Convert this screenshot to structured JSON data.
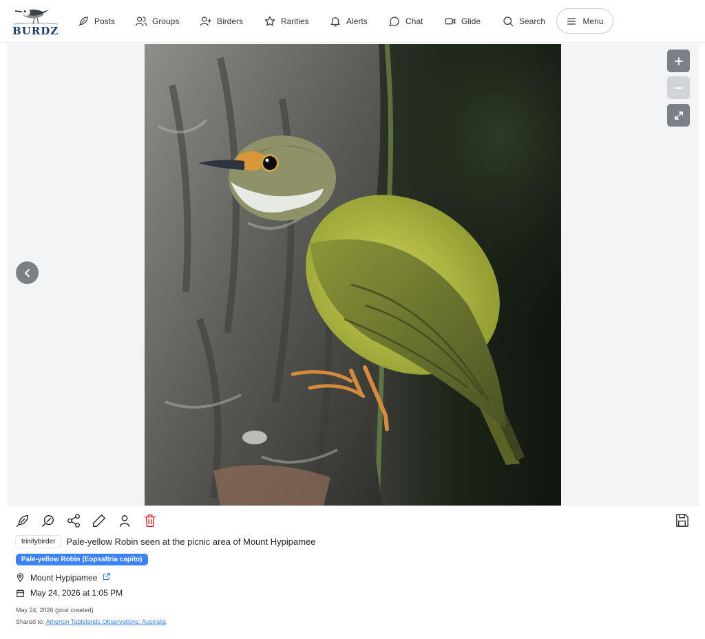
{
  "brand": {
    "name": "BURDZ"
  },
  "nav": [
    {
      "key": "posts",
      "label": "Posts",
      "icon": "feather-icon"
    },
    {
      "key": "groups",
      "label": "Groups",
      "icon": "users-icon"
    },
    {
      "key": "birders",
      "label": "Birders",
      "icon": "user-plus-icon"
    },
    {
      "key": "rarities",
      "label": "Rarities",
      "icon": "star-icon"
    },
    {
      "key": "alerts",
      "label": "Alerts",
      "icon": "bell-icon"
    },
    {
      "key": "chat",
      "label": "Chat",
      "icon": "chat-bubble-icon"
    },
    {
      "key": "glide",
      "label": "Glide",
      "icon": "video-camera-icon"
    },
    {
      "key": "search",
      "label": "Search",
      "icon": "search-icon"
    }
  ],
  "menu": {
    "label": "Menu",
    "icon": "hamburger-icon"
  },
  "viewer": {
    "zoom_in_icon": "plus-icon",
    "zoom_out_icon": "minus-icon",
    "zoom_out_disabled": true,
    "fullscreen_icon": "expand-icon",
    "prev_icon": "chevron-left-icon"
  },
  "post": {
    "username": "trinitybirder",
    "caption": "Pale-yellow Robin seen at the picnic area of Mount Hypipamee",
    "species_tag": "Pale-yellow Robin (Eopsaltria capito)",
    "location": "Mount Hypipamee",
    "observed_at": "May 24, 2026 at 1:05 PM",
    "created": "May 24, 2026 (post created)",
    "shared_prefix": "Shared to:",
    "shared_group": "Atherton Tablelands Observations: Australia"
  },
  "colors": {
    "accent": "#3b82f6",
    "danger": "#dc2626",
    "control_gray": "#7b8087"
  }
}
